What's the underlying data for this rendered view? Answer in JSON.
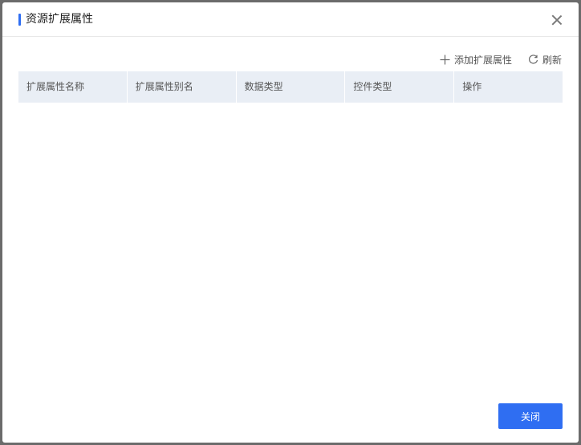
{
  "dialog": {
    "title": "资源扩展属性",
    "accent_color": "#2f6ef2"
  },
  "toolbar": {
    "add_label": "添加扩展属性",
    "refresh_label": "刷新"
  },
  "table": {
    "columns": [
      "扩展属性名称",
      "扩展属性别名",
      "数据类型",
      "控件类型",
      "操作"
    ],
    "rows": []
  },
  "footer": {
    "close_label": "关闭"
  }
}
